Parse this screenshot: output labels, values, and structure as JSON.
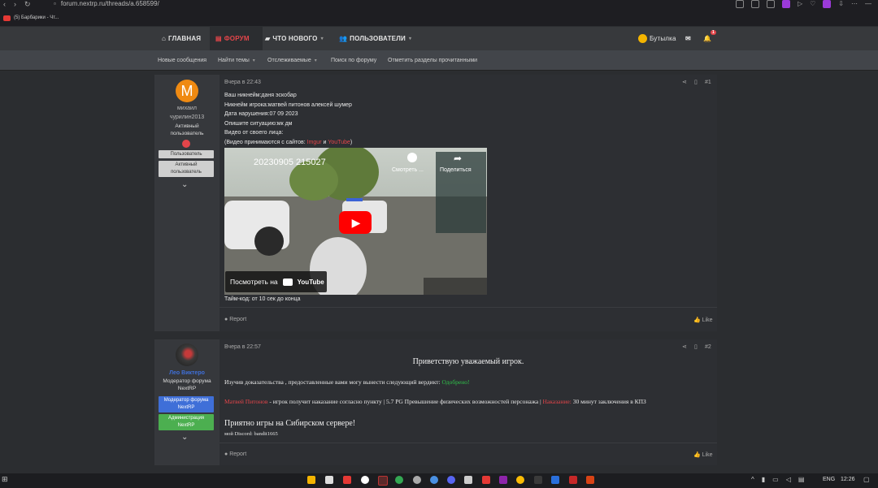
{
  "browser": {
    "url": "forum.nextrp.ru/threads/a.658599/",
    "bookmark": "(5) Барбарики - Чт..."
  },
  "nav": {
    "home": "ГЛАВНАЯ",
    "forum": "ФОРУМ",
    "whats_new": "ЧТО НОВОГО",
    "users": "ПОЛЬЗОВАТЕЛИ",
    "account": "Бутылка",
    "alert_count": "1"
  },
  "subnav": {
    "new_messages": "Новые сообщения",
    "find_threads": "Найти темы",
    "watched": "Отслеживаемые",
    "search_forum": "Поиск по форуму",
    "mark_read": "Отметить разделы прочитанными"
  },
  "post1": {
    "avatar_letter": "M",
    "username_line1": "михаил",
    "username_line2": "чурилин2013",
    "title_line1": "Активный",
    "title_line2": "пользователь",
    "badge1": "Пользователь",
    "badge2_line1": "Активный",
    "badge2_line2": "пользователь",
    "time": "Вчера в 22:43",
    "number": "#1",
    "lines": [
      "Ваш никнейм:даня эскобар",
      "Никнейм игрока:матвей питонов алексей шумер",
      "Дата нарушения:07 09 2023",
      "Опишите ситуацию:мк дм",
      "Видео от своего лица:"
    ],
    "video_note_prefix": "(Видео принимаются с сайтов: ",
    "video_note_imgur": "Imgur",
    "video_note_and": " и ",
    "video_note_youtube": "YouTube",
    "video_note_suffix": ")",
    "video": {
      "title": "20230905 215027",
      "watch_later": "Смотреть ...",
      "share": "Поделиться",
      "watch_on": "Посмотреть на",
      "youtube": "YouTube"
    },
    "timecode": "Тайм-код: от 10 сек до конца",
    "report": "Report",
    "like": "Like"
  },
  "post2": {
    "username": "Лео Виктеро",
    "title_line1": "Модератор форума",
    "title_line2": "NextRP",
    "badge1_line1": "Модератор форума",
    "badge1_line2": "NextRP",
    "badge2_line1": "Администрация",
    "badge2_line2": "NextRP",
    "time": "Вчера в 22:57",
    "number": "#2",
    "greeting": "Приветствую уважаемый игрок.",
    "verdict_prefix": "Изучив доказательства , предоставленные вами могу вынести следующий вердикт: ",
    "verdict": "Одобрено!",
    "punish_name": "Матвей Питонов",
    "punish_text": " - игрок получит наказание согласно пункту | 5.7 PG Превышение физических возможностей персонажа | ",
    "punish_label": "Наказание:",
    "punish_value": " 30 минут заключения в КПЗ",
    "closing": "Приятно игры на Сибирском сервере!",
    "discord": "мой Discord: bandit1665",
    "report": "Report",
    "like": "Like"
  },
  "taskbar": {
    "lang": "ENG",
    "time": "12:26"
  },
  "colors": {
    "accent": "#e4454a",
    "approved": "#2fc34a",
    "moderator_badge": "#3f6fd8",
    "admin_badge": "#4caf50"
  }
}
